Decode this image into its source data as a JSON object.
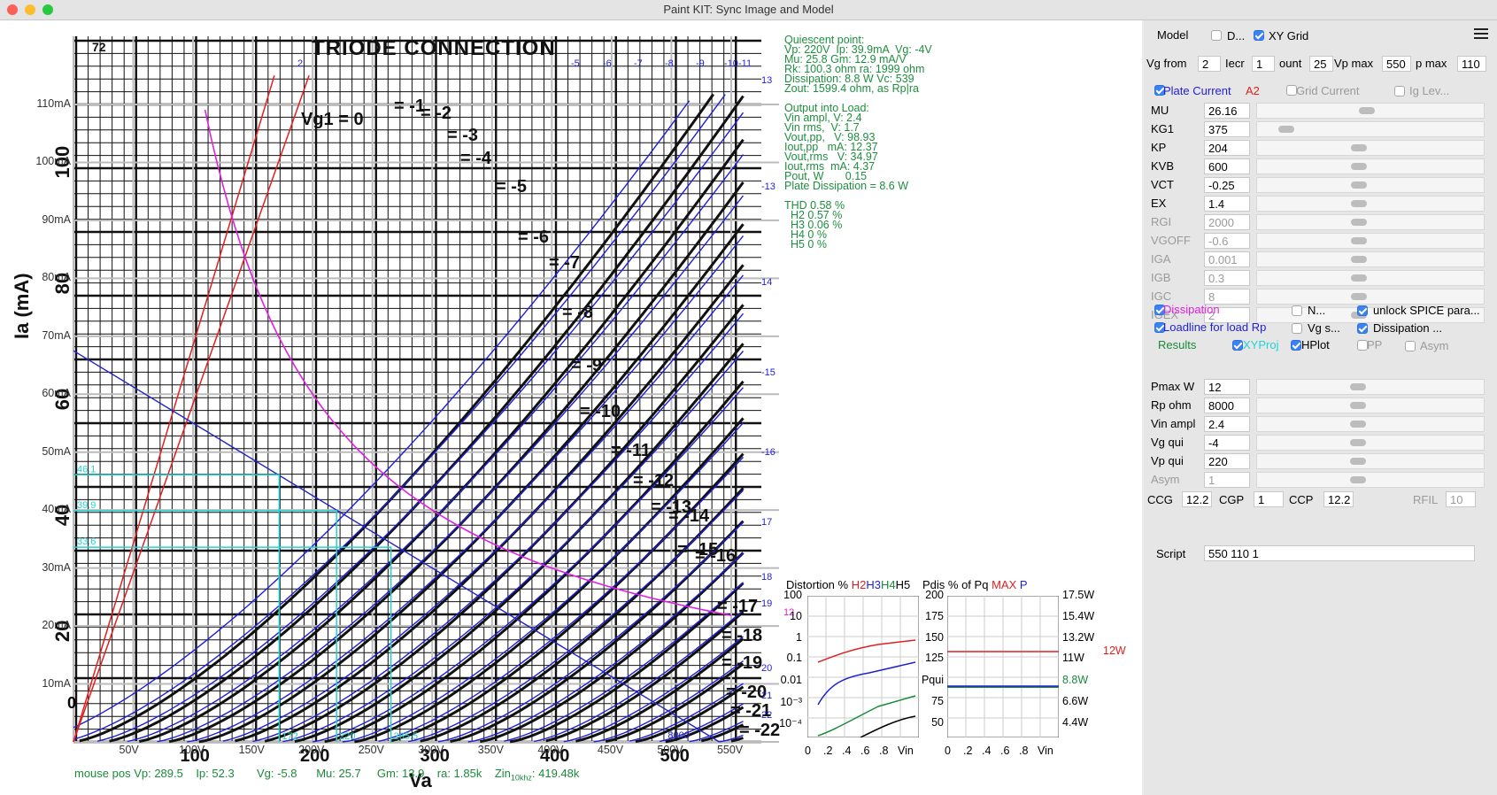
{
  "window": {
    "title": "Paint KIT: Sync Image and Model"
  },
  "plot": {
    "y_ticks": [
      "110mA",
      "100mA",
      "90mA",
      "80mA",
      "70mA",
      "60mA",
      "50mA",
      "40mA",
      "30mA",
      "20mA",
      "10mA"
    ],
    "x_ticks": [
      "50V",
      "100V",
      "150V",
      "200V",
      "250V",
      "300V",
      "350V",
      "400V",
      "450V",
      "500V",
      "550V"
    ],
    "x_zero": "0",
    "datasheet_title": "TRIODE CONNECTION",
    "datasheet_code": "72",
    "scan_y_ticks": [
      "100",
      "80",
      "60",
      "40",
      "20"
    ],
    "scan_x_ticks": [
      "100",
      "200",
      "300",
      "400",
      "500"
    ],
    "grid_labels_top": [
      "2",
      "-5",
      "-6",
      "-7",
      "-8",
      "-9",
      "-10",
      "-11"
    ],
    "grid_labels_right": [
      "13",
      "-13",
      "14",
      "-15",
      "-16",
      "17",
      "18",
      "19",
      "20",
      "21",
      "22"
    ],
    "scan_grid_labels": [
      "Vg1 = 0",
      "= -1",
      "= -2",
      "= -3",
      "= -4",
      "= -5",
      "= -6",
      "= -7",
      "= -8",
      "= -9",
      "= -10",
      "= -11",
      "= -12",
      "= -13",
      "= -14",
      "= -15",
      "= -16",
      "= -17",
      "= -18",
      "= -19",
      "= -20",
      "= -21",
      "= -22"
    ],
    "cyan_labels": [
      "46.1",
      "39.9",
      "33.6"
    ],
    "cyan_bottom": [
      "172",
      "220",
      "265.5"
    ],
    "load_label": "8000",
    "ia_label": "Ia  (mA)",
    "va_label": "Va",
    "mouse": {
      "pos_vp": "mouse pos Vp: 289.5",
      "ip": "Ip: 52.3",
      "vg": "Vg: -5.8",
      "mu": "Mu: 25.7",
      "gm": "Gm: 13.9",
      "ra": "ra: 1.85k",
      "zin": "Zin",
      "zin_sub": "10khz",
      "zin_val": ": 419.48k"
    }
  },
  "info": {
    "lines": [
      "Quiescent point:",
      "Vp: 220V  Ip: 39.9mA  Vg: -4V",
      "Mu: 25.8 Gm: 12.9 mA/V",
      "Rk: 100.3 ohm ra: 1999 ohm",
      "Dissipation: 8.8 W Vc: 539",
      "Zout: 1599.4 ohm, as Rp|ra",
      "",
      "Output into Load:",
      "Vin ampl, V: 2.4",
      "Vin rms,  V: 1.7",
      "Vout,pp,   V: 98.93",
      "Iout,pp   mA: 12.37",
      "Vout,rms   V: 34.97",
      "Iout,rms  mA: 4.37",
      "Pout, W       0.15",
      "Plate Dissipation = 8.6 W",
      "",
      "THD 0.58 %",
      "  H2 0.57 %",
      "  H3 0.06 %",
      "  H4 0 %",
      "  H5 0 %"
    ]
  },
  "distortion": {
    "title": "Distortion %",
    "h2": "H2",
    "h3": "H3",
    "h4": "H4",
    "h5": "H5",
    "y_ticks": [
      "100",
      "10",
      "1",
      "0.1",
      "0.01",
      "10-3",
      "10-4"
    ],
    "x_ticks": [
      "0",
      ".2",
      ".4",
      ".6",
      ".8",
      "Vin"
    ]
  },
  "pdis": {
    "title": "Pdis % of Pq",
    "max": "MAX",
    "p": "P",
    "y_left": [
      "200",
      "175",
      "150",
      "125",
      "Pqui",
      "75",
      "50"
    ],
    "y_right": [
      "17.5W",
      "15.4W",
      "13.2W",
      "11W",
      "8.8W",
      "6.6W",
      "4.4W"
    ],
    "max_label": "12W",
    "x_ticks": [
      "0",
      ".2",
      ".4",
      ".6",
      ".8",
      "Vin"
    ]
  },
  "panel": {
    "model_label": "Model",
    "d_label": "D...",
    "xygrid_label": "XY Grid",
    "vg_from_label": "Vg from",
    "vg_from": "2",
    "incr_label": "Iecr",
    "incr": "1",
    "count_label": "ount",
    "count": "25",
    "vpmax_label": "Vp max",
    "vpmax": "550",
    "pmax_label": "p max",
    "pmax": "110",
    "plate_current": "Plate Current",
    "a2": "A2",
    "grid_current": "Grid Current",
    "ig_lev": "Ig Lev...",
    "params": [
      {
        "name": "MU",
        "value": "26.16"
      },
      {
        "name": "KG1",
        "value": "375"
      },
      {
        "name": "KP",
        "value": "204"
      },
      {
        "name": "KVB",
        "value": "600"
      },
      {
        "name": "VCT",
        "value": "-0.25"
      },
      {
        "name": "EX",
        "value": "1.4"
      },
      {
        "name": "RGI",
        "value": "2000"
      },
      {
        "name": "VGOFF",
        "value": "-0.6"
      },
      {
        "name": "IGA",
        "value": "0.001"
      },
      {
        "name": "IGB",
        "value": "0.3"
      },
      {
        "name": "IGC",
        "value": "8"
      },
      {
        "name": "IGEX",
        "value": "2"
      }
    ],
    "dissipation": "Dissipation",
    "n_label": "N...",
    "unlock_spice": "unlock SPICE para...",
    "loadline": "Loadline for load Rp",
    "vg_s": "Vg s...",
    "dissipation2": "Dissipation ...",
    "results": "Results",
    "xyproj": "XYProj",
    "hplot": "HPlot",
    "pp": "PP",
    "asym_cb": "Asym",
    "loadparams": [
      {
        "name": "Pmax W",
        "value": "12"
      },
      {
        "name": "Rp ohm",
        "value": "8000"
      },
      {
        "name": "Vin ampl",
        "value": "2.4"
      },
      {
        "name": "Vg qui",
        "value": "-4"
      },
      {
        "name": "Vp qui",
        "value": "220"
      },
      {
        "name": "Asym",
        "value": "1"
      }
    ],
    "ccg_label": "CCG",
    "ccg": "12.2",
    "cgp_label": "CGP",
    "cgp": "1",
    "ccp_label": "CCP",
    "ccp": "12.2",
    "rfil_label": "RFIL",
    "rfil": "10",
    "script_label": "Script",
    "script": "550 110 1"
  },
  "colors": {
    "curve_blue": "#1f1fd6",
    "dissipation": "#e020e0",
    "loadline": "#2323c8",
    "cyan": "#22d3d3",
    "info_green": "#1e8f3e",
    "red_line": "#e02020"
  }
}
